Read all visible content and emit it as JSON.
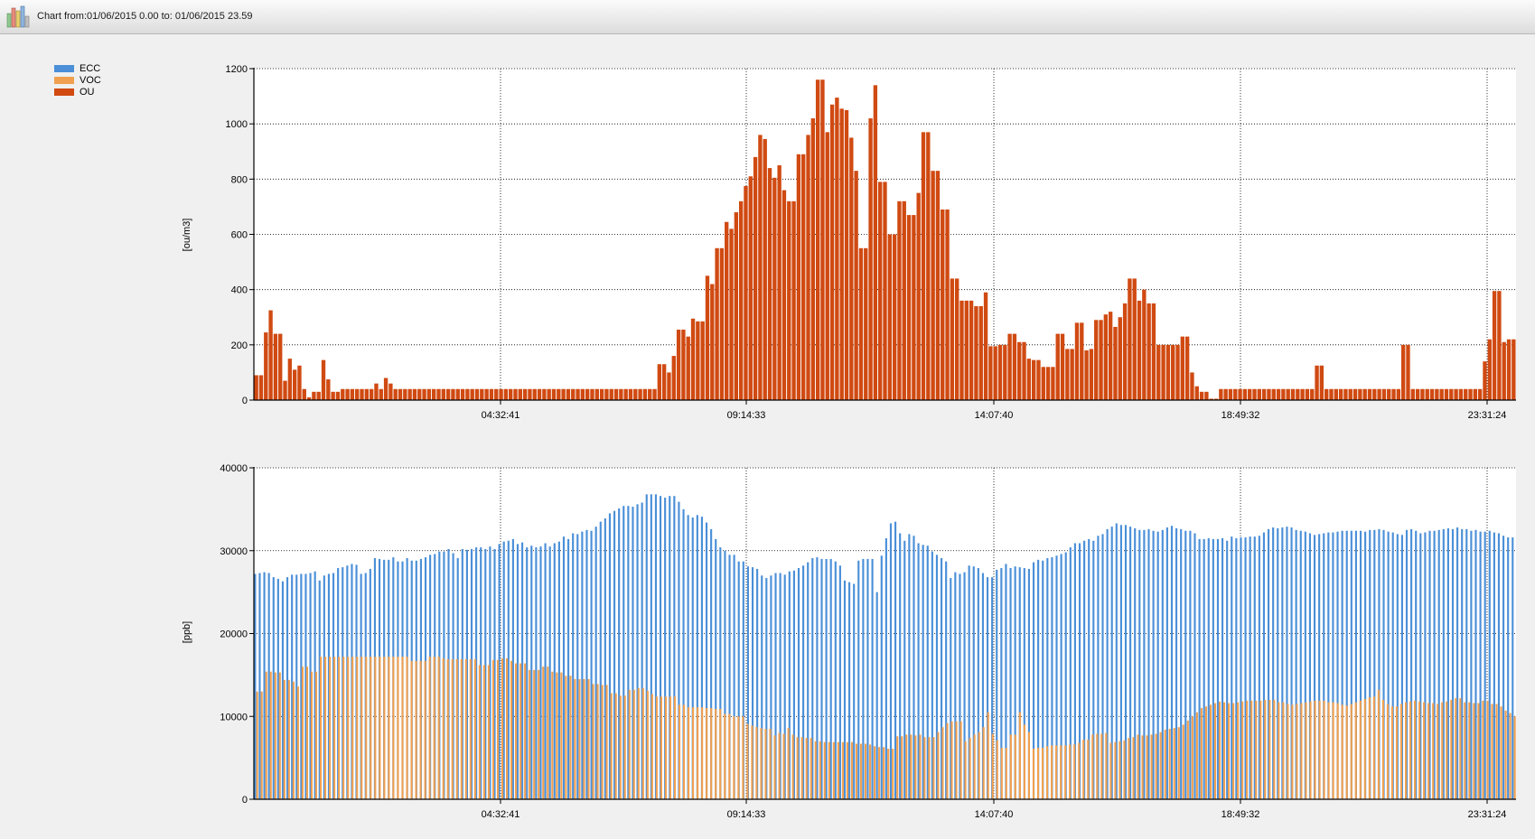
{
  "window": {
    "title": "Chart from:01/06/2015 0.00 to: 01/06/2015 23.59",
    "icon": "bar-chart-icon"
  },
  "legend": [
    {
      "label": "ECC",
      "color": "#4a8fd8"
    },
    {
      "label": "VOC",
      "color": "#f0a050"
    },
    {
      "label": "OU",
      "color": "#d04a12"
    }
  ],
  "chart_data": [
    {
      "type": "bar",
      "ylabel": "[ou/m3]",
      "ylim": [
        0,
        1200
      ],
      "yticks": [
        0,
        200,
        400,
        600,
        800,
        1000,
        1200
      ],
      "xticks": [
        "04:32:41",
        "09:14:33",
        "14:07:40",
        "18:49:32",
        "23:31:24"
      ],
      "grid": true,
      "series": [
        {
          "name": "OU",
          "color": "#d04a12",
          "values": [
            90,
            90,
            245,
            325,
            240,
            240,
            70,
            150,
            110,
            125,
            40,
            10,
            30,
            30,
            145,
            75,
            30,
            30,
            40,
            40,
            40,
            40,
            40,
            40,
            40,
            60,
            40,
            80,
            60,
            40,
            40,
            40,
            40,
            40,
            40,
            40,
            40,
            40,
            40,
            40,
            40,
            40,
            40,
            40,
            40,
            40,
            40,
            40,
            40,
            40,
            40,
            40,
            40,
            40,
            40,
            40,
            40,
            40,
            40,
            40,
            40,
            40,
            40,
            40,
            40,
            40,
            40,
            40,
            40,
            40,
            40,
            40,
            40,
            40,
            40,
            40,
            40,
            40,
            40,
            40,
            40,
            40,
            40,
            40,
            130,
            130,
            100,
            160,
            255,
            255,
            230,
            295,
            285,
            285,
            450,
            420,
            550,
            550,
            645,
            620,
            680,
            720,
            775,
            810,
            880,
            960,
            945,
            840,
            805,
            850,
            760,
            720,
            720,
            890,
            890,
            960,
            1020,
            1160,
            1160,
            970,
            1070,
            1095,
            1055,
            1050,
            950,
            830,
            550,
            550,
            1020,
            1140,
            790,
            790,
            600,
            600,
            720,
            720,
            670,
            670,
            750,
            970,
            970,
            830,
            830,
            690,
            690,
            440,
            440,
            360,
            360,
            360,
            340,
            340,
            390,
            195,
            195,
            200,
            200,
            240,
            240,
            210,
            210,
            150,
            145,
            145,
            120,
            120,
            120,
            240,
            240,
            185,
            185,
            280,
            280,
            180,
            185,
            290,
            290,
            310,
            320,
            265,
            300,
            350,
            440,
            440,
            360,
            400,
            350,
            350,
            200,
            200,
            200,
            200,
            200,
            230,
            230,
            100,
            50,
            30,
            30,
            5,
            5,
            40,
            40,
            40,
            40,
            40,
            40,
            40,
            40,
            40,
            40,
            40,
            40,
            40,
            40,
            40,
            40,
            40,
            40,
            40,
            40,
            125,
            125,
            40,
            40,
            40,
            40,
            40,
            40,
            40,
            40,
            40,
            40,
            40,
            40,
            40,
            40,
            40,
            40,
            200,
            200,
            40,
            40,
            40,
            40,
            40,
            40,
            40,
            40,
            40,
            40,
            40,
            40,
            40,
            40,
            40,
            140,
            220,
            395,
            395,
            210,
            220,
            220
          ]
        }
      ]
    },
    {
      "type": "bar",
      "ylabel": "[ppb]",
      "ylim": [
        0,
        40000
      ],
      "yticks": [
        0,
        10000,
        20000,
        30000,
        40000
      ],
      "xticks": [
        "04:32:41",
        "09:14:33",
        "14:07:40",
        "18:49:32",
        "23:31:24"
      ],
      "grid": true,
      "series": [
        {
          "name": "ECC",
          "color": "#4a8fd8",
          "values": [
            27200,
            27300,
            27400,
            27300,
            26800,
            26600,
            26300,
            26800,
            27100,
            27100,
            27200,
            27200,
            27300,
            27500,
            26400,
            27000,
            27200,
            27300,
            27900,
            28000,
            28200,
            28400,
            28300,
            27200,
            27300,
            27800,
            29100,
            29000,
            28900,
            28900,
            29200,
            28700,
            28700,
            29100,
            28800,
            28800,
            29000,
            29200,
            29500,
            29600,
            29900,
            29900,
            30200,
            29700,
            29100,
            30200,
            30100,
            30200,
            30400,
            30400,
            30200,
            30500,
            30200,
            30800,
            31100,
            31200,
            31400,
            30800,
            31000,
            30400,
            30600,
            30400,
            30500,
            30900,
            30500,
            30900,
            31100,
            31700,
            31400,
            32100,
            32000,
            32300,
            32500,
            32400,
            32900,
            33500,
            33900,
            34500,
            34800,
            35100,
            35400,
            35400,
            35300,
            35600,
            35800,
            36800,
            36800,
            36800,
            36600,
            36400,
            36600,
            36600,
            35900,
            35000,
            34300,
            34000,
            34300,
            34100,
            33400,
            32600,
            31400,
            30400,
            30000,
            29500,
            29500,
            28700,
            28700,
            28100,
            28000,
            27800,
            27000,
            26700,
            27000,
            27300,
            27300,
            27100,
            27500,
            27600,
            27900,
            28200,
            28600,
            29100,
            29200,
            29000,
            29000,
            29000,
            28700,
            28200,
            26400,
            26200,
            26000,
            28800,
            29000,
            29000,
            29000,
            25000,
            29400,
            31500,
            33300,
            33500,
            32100,
            31200,
            32000,
            31800,
            30900,
            30700,
            30600,
            29900,
            29500,
            29100,
            28700,
            26700,
            27400,
            27200,
            27400,
            28200,
            28100,
            27900,
            27300,
            26800,
            26800,
            27700,
            27900,
            28400,
            27900,
            28100,
            28000,
            27900,
            27800,
            28600,
            28900,
            28800,
            29100,
            29200,
            29400,
            29600,
            29800,
            30400,
            30900,
            30900,
            31200,
            31400,
            31200,
            31800,
            32000,
            32600,
            32900,
            33300,
            33100,
            33100,
            32900,
            32700,
            32500,
            32500,
            32600,
            32400,
            32300,
            32500,
            32800,
            33000,
            32700,
            32600,
            32400,
            32400,
            32100,
            31400,
            31400,
            31500,
            31400,
            31400,
            31500,
            31200,
            31700,
            31500,
            31600,
            31600,
            31700,
            31700,
            31800,
            32200,
            32600,
            32800,
            32700,
            32800,
            32900,
            32800,
            32500,
            32400,
            32300,
            32100,
            31900,
            32000,
            32100,
            32200,
            32200,
            32300,
            32400,
            32400,
            32400,
            32400,
            32400,
            32300,
            32500,
            32500,
            32600,
            32500,
            32300,
            32200,
            32000,
            31900,
            32500,
            32600,
            32400,
            32100,
            32200,
            32400,
            32400,
            32500,
            32600,
            32700,
            32600,
            32800,
            32600,
            32600,
            32400,
            32500,
            32300,
            32300,
            32400,
            32200,
            32100,
            31800,
            31600,
            31600
          ]
        },
        {
          "name": "VOC",
          "color": "#f0a050",
          "values": [
            13000,
            13000,
            15400,
            15400,
            15300,
            15300,
            14400,
            14400,
            14200,
            13600,
            16000,
            16000,
            15400,
            15400,
            17200,
            17200,
            17200,
            17200,
            17200,
            17200,
            17200,
            17200,
            17200,
            17200,
            17200,
            17200,
            17200,
            17200,
            17200,
            17200,
            17200,
            17200,
            17200,
            17200,
            16700,
            16700,
            16700,
            16700,
            17200,
            17200,
            17200,
            17000,
            16900,
            16900,
            16900,
            16900,
            16900,
            16900,
            16900,
            16200,
            16200,
            16200,
            16800,
            16800,
            17000,
            17000,
            16700,
            16400,
            16400,
            16400,
            15600,
            15600,
            15600,
            16000,
            16000,
            15400,
            15300,
            15300,
            14900,
            14900,
            14500,
            14500,
            14500,
            14500,
            13900,
            13900,
            13800,
            13800,
            12800,
            12800,
            12500,
            12500,
            13200,
            13200,
            13400,
            13400,
            13100,
            12700,
            12400,
            12400,
            12400,
            12400,
            12400,
            11400,
            11400,
            11100,
            11100,
            11100,
            11100,
            11000,
            11000,
            10900,
            10900,
            10300,
            10300,
            10000,
            10000,
            10000,
            9100,
            8900,
            8700,
            8600,
            8500,
            8500,
            7700,
            8000,
            7900,
            8600,
            7800,
            7500,
            7500,
            7400,
            7400,
            7000,
            7000,
            6900,
            6900,
            6900,
            6900,
            6900,
            6900,
            6900,
            6700,
            6700,
            6700,
            6600,
            6400,
            6300,
            6300,
            6100,
            6100,
            7600,
            7600,
            7800,
            7800,
            7700,
            7800,
            7500,
            7500,
            7500,
            8100,
            8700,
            9200,
            9400,
            9400,
            9400,
            7000,
            7400,
            7800,
            8100,
            8700,
            10500,
            7900,
            7100,
            6200,
            6200,
            7800,
            7800,
            10500,
            9000,
            8100,
            6100,
            6200,
            6200,
            6400,
            6500,
            6500,
            6500,
            6500,
            6600,
            6600,
            6800,
            7200,
            7200,
            7800,
            7900,
            7900,
            8000,
            6800,
            6900,
            7000,
            7100,
            7400,
            7500,
            7800,
            7700,
            7700,
            7800,
            7900,
            8100,
            8400,
            8500,
            8600,
            8700,
            9000,
            9500,
            10000,
            10500,
            11000,
            11200,
            11400,
            11600,
            11800,
            11700,
            11600,
            11600,
            11700,
            11800,
            11900,
            11900,
            11900,
            11900,
            12000,
            12000,
            12000,
            11700,
            11700,
            11500,
            11400,
            11500,
            11600,
            11700,
            11800,
            11900,
            11900,
            11900,
            11700,
            11700,
            11600,
            11400,
            11300,
            11500,
            11700,
            11900,
            12100,
            12300,
            12400,
            13200,
            12000,
            11500,
            11200,
            11200,
            11500,
            11700,
            11800,
            11900,
            11800,
            11700,
            11600,
            11600,
            11500,
            11700,
            11800,
            12000,
            12200,
            12200,
            11700,
            11700,
            11600,
            11600,
            11900,
            11900,
            11500,
            11500,
            11200,
            10700,
            10400,
            10000
          ]
        }
      ]
    }
  ]
}
